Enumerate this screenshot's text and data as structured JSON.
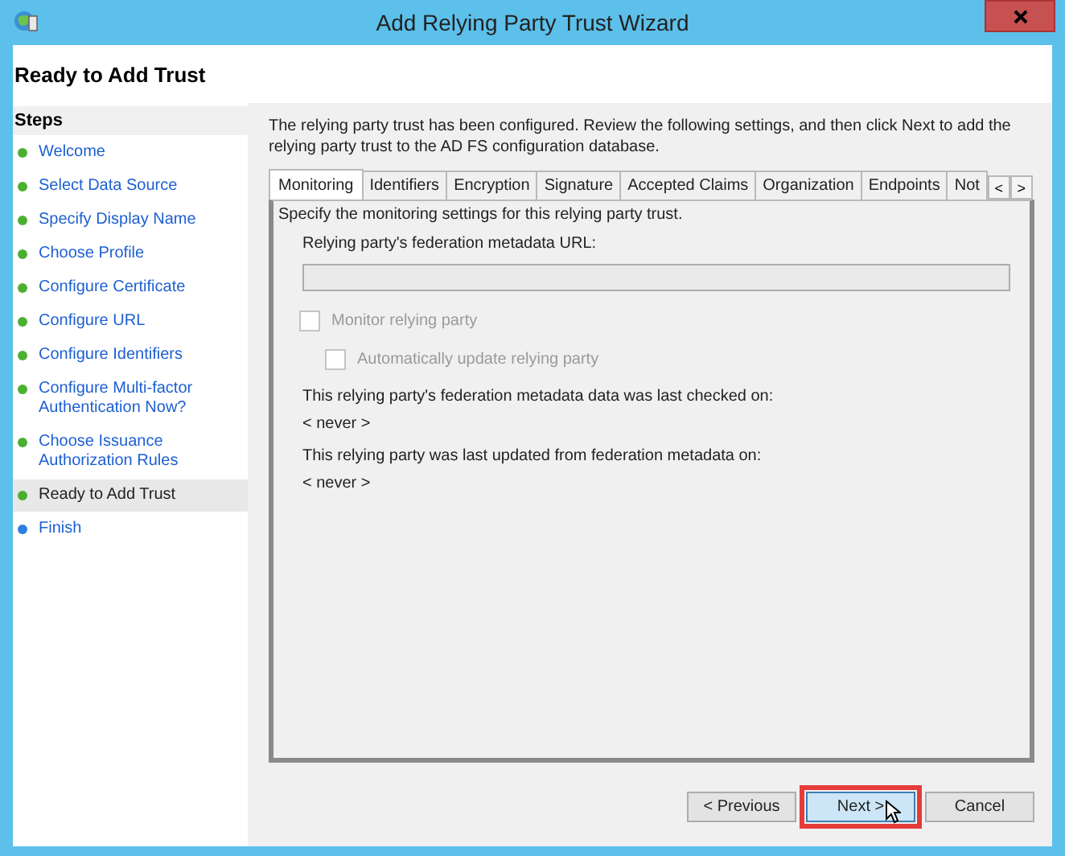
{
  "window": {
    "title": "Add Relying Party Trust Wizard"
  },
  "page_title": "Ready to Add Trust",
  "steps": {
    "heading": "Steps",
    "items": [
      {
        "label": "Welcome",
        "kind": "done",
        "selected": false
      },
      {
        "label": "Select Data Source",
        "kind": "done",
        "selected": false
      },
      {
        "label": "Specify Display Name",
        "kind": "done",
        "selected": false
      },
      {
        "label": "Choose Profile",
        "kind": "done",
        "selected": false
      },
      {
        "label": "Configure Certificate",
        "kind": "done",
        "selected": false
      },
      {
        "label": "Configure URL",
        "kind": "done",
        "selected": false
      },
      {
        "label": "Configure Identifiers",
        "kind": "done",
        "selected": false
      },
      {
        "label": "Configure Multi-factor Authentication Now?",
        "kind": "done",
        "selected": false
      },
      {
        "label": "Choose Issuance Authorization Rules",
        "kind": "done",
        "selected": false
      },
      {
        "label": "Ready to Add Trust",
        "kind": "done",
        "selected": true
      },
      {
        "label": "Finish",
        "kind": "pending",
        "selected": false
      }
    ]
  },
  "intro": "The relying party trust has been configured. Review the following settings, and then click Next to add the relying party trust to the AD FS configuration database.",
  "tabs": [
    {
      "label": "Monitoring",
      "selected": true
    },
    {
      "label": "Identifiers",
      "selected": false
    },
    {
      "label": "Encryption",
      "selected": false
    },
    {
      "label": "Signature",
      "selected": false
    },
    {
      "label": "Accepted Claims",
      "selected": false
    },
    {
      "label": "Organization",
      "selected": false
    },
    {
      "label": "Endpoints",
      "selected": false
    },
    {
      "label": "Not",
      "selected": false
    }
  ],
  "tab_scroll": [
    "<",
    ">"
  ],
  "monitoring": {
    "description": "Specify the monitoring settings for this relying party trust.",
    "url_label": "Relying party's federation metadata URL:",
    "url_disabled": true,
    "checkboxes": [
      {
        "label": "Monitor relying party",
        "checked": false,
        "disabled": true,
        "indented": false
      },
      {
        "label": "Automatically update relying party",
        "checked": false,
        "disabled": true,
        "indented": true
      }
    ],
    "fields": [
      {
        "label": "This relying party's federation metadata data was last checked on:",
        "value": "< never >"
      },
      {
        "label": "This relying party was last updated from federation metadata on:",
        "value": "< never >"
      }
    ]
  },
  "buttons": [
    {
      "label": "< Previous",
      "focused": false
    },
    {
      "label": "Next >",
      "focused": true
    },
    {
      "label": "Cancel",
      "focused": false
    }
  ]
}
